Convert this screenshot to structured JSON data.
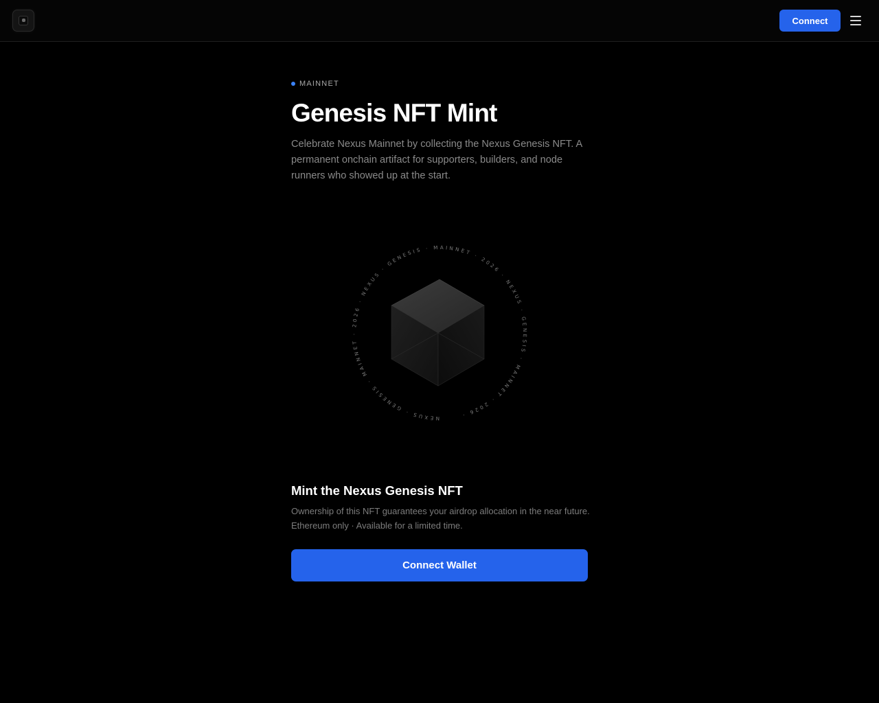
{
  "header": {
    "logo_icon": "nexus-logo-icon",
    "connect_label": "Connect",
    "menu_icon": "hamburger-menu-icon"
  },
  "hero": {
    "network_label": "MAINNET",
    "title": "Genesis NFT Mint",
    "description": "Celebrate Nexus Mainnet by collecting the Nexus Genesis NFT. A permanent onchain artifact for supporters, builders, and node runners who showed up at the start."
  },
  "artwork": {
    "ring_text": "NEXUS · GENESIS · MAINNET · 2026 · NEXUS · GENESIS · MAINNET · 2026 · NEXUS · GENESIS · MAINNET · 2026 · ",
    "icon": "hexagonal-cube-icon"
  },
  "mint": {
    "title": "Mint the Nexus Genesis NFT",
    "description": "Ownership of this NFT guarantees your airdrop allocation in the near future. Ethereum only · Available for a limited time.",
    "connect_wallet_label": "Connect Wallet"
  },
  "colors": {
    "accent": "#2563eb",
    "network_dot": "#3b82f6",
    "background": "#000000"
  }
}
